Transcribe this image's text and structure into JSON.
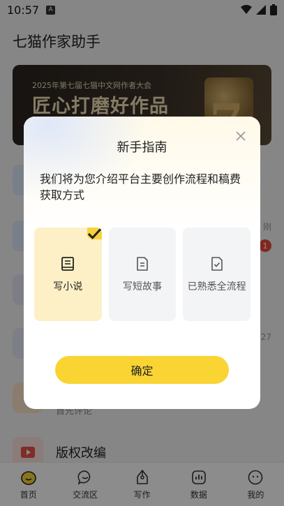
{
  "status_bar": {
    "time": "10:57",
    "badge": "A"
  },
  "app": {
    "title": "七猫作家助手"
  },
  "banner": {
    "subtitle": "2025年第七届七猫中文网作者大会",
    "headline": "匠心打磨好作品"
  },
  "list": {
    "items": [
      {
        "title": "",
        "desc": ""
      },
      {
        "title": "",
        "desc": ""
      },
      {
        "title": "",
        "desc": ""
      },
      {
        "title": "",
        "desc": ""
      },
      {
        "title": "",
        "desc": "首先评论"
      },
      {
        "title": "版权改编",
        "desc": ""
      }
    ],
    "side_badge": "1",
    "side_text_1": "刚",
    "side_text_2": "27"
  },
  "bottom_nav": {
    "items": [
      {
        "label": "首页",
        "icon": "home-icon"
      },
      {
        "label": "交流区",
        "icon": "chat-icon"
      },
      {
        "label": "写作",
        "icon": "pen-icon"
      },
      {
        "label": "数据",
        "icon": "chart-icon"
      },
      {
        "label": "我的",
        "icon": "profile-icon"
      }
    ]
  },
  "modal": {
    "title": "新手指南",
    "description": "我们将为您介绍平台主要创作流程和稿费获取方式",
    "options": [
      {
        "label": "写小说",
        "icon": "book-icon",
        "selected": true
      },
      {
        "label": "写短故事",
        "icon": "document-icon",
        "selected": false
      },
      {
        "label": "已熟悉全流程",
        "icon": "checked-document-icon",
        "selected": false
      }
    ],
    "confirm_label": "确定"
  },
  "colors": {
    "accent": "#f9d433",
    "selected_bg": "#fdf0c6",
    "badge_red": "#e84a3c"
  }
}
